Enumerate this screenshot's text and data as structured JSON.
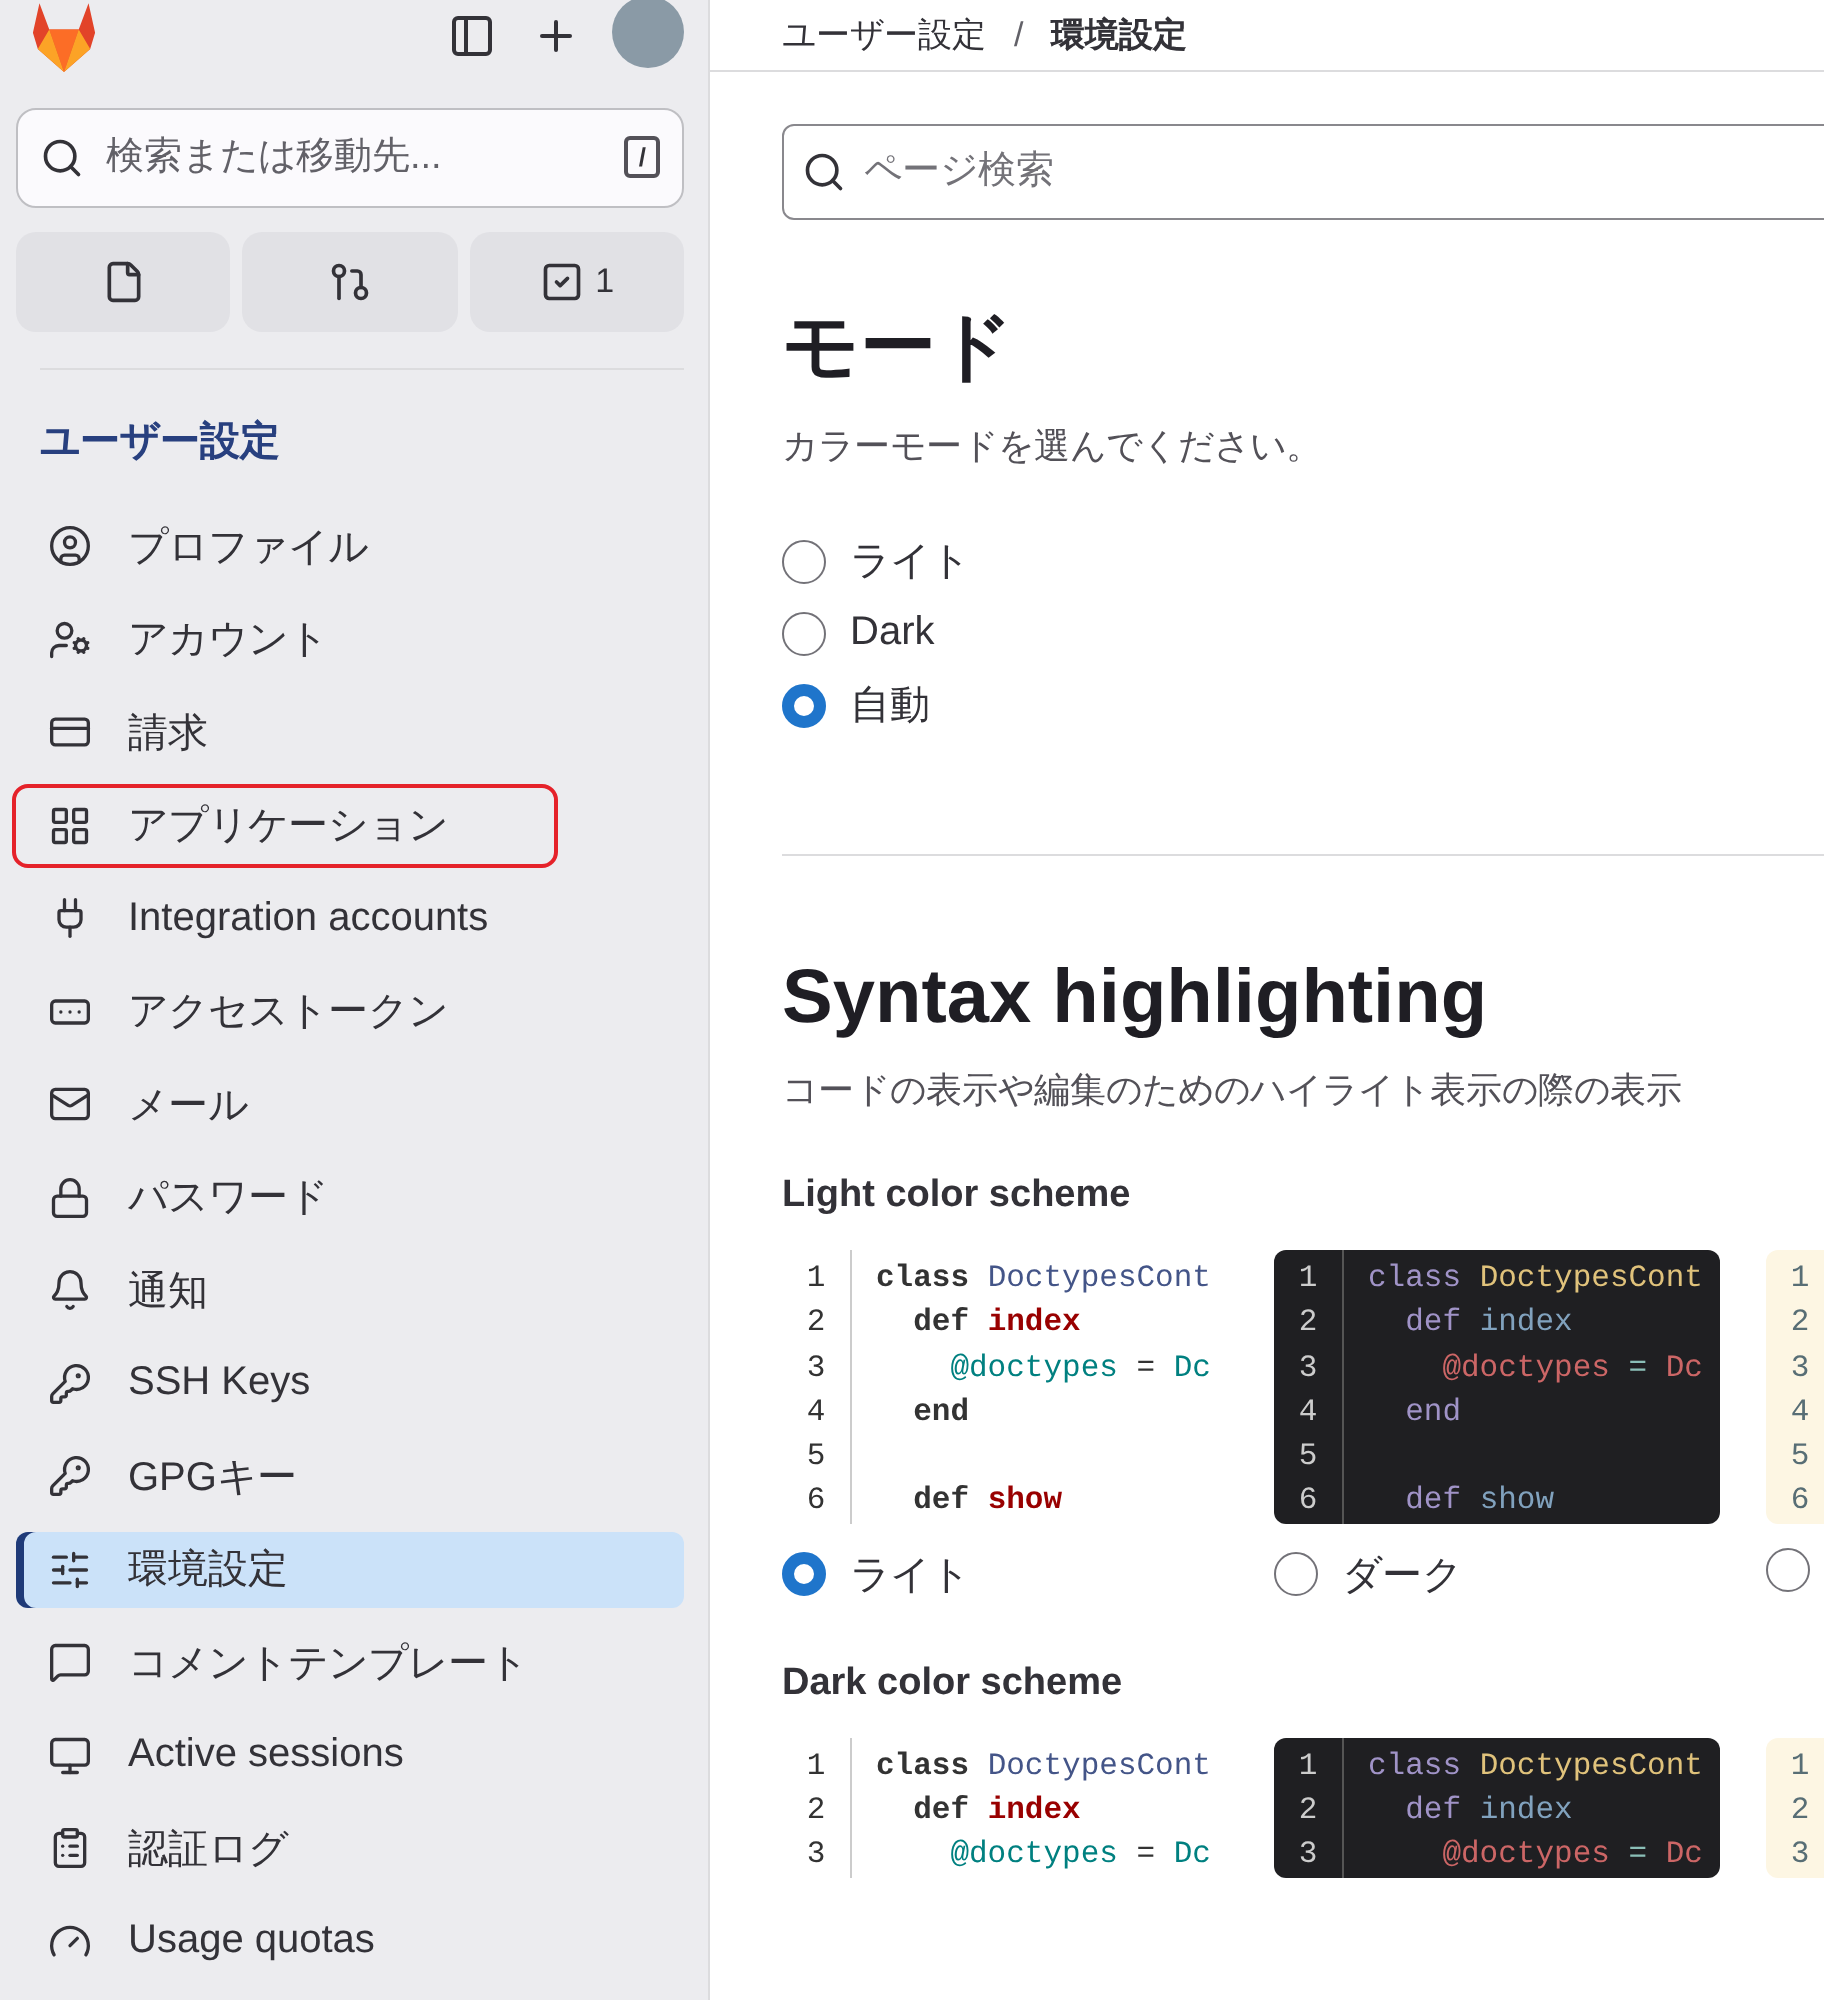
{
  "sidebar": {
    "search": {
      "placeholder": "検索または移動先...",
      "shortcut": "/"
    },
    "quick_buttons": [
      {
        "kind": "issues"
      },
      {
        "kind": "merge_requests"
      },
      {
        "kind": "todos",
        "count": "1"
      }
    ],
    "heading": "ユーザー設定",
    "items": [
      {
        "label": "プロファイル",
        "selected": false,
        "highlighted": false
      },
      {
        "label": "アカウント",
        "selected": false,
        "highlighted": false
      },
      {
        "label": "請求",
        "selected": false,
        "highlighted": false
      },
      {
        "label": "アプリケーション",
        "selected": false,
        "highlighted": true
      },
      {
        "label": "Integration accounts",
        "selected": false,
        "highlighted": false
      },
      {
        "label": "アクセストークン",
        "selected": false,
        "highlighted": false
      },
      {
        "label": "メール",
        "selected": false,
        "highlighted": false
      },
      {
        "label": "パスワード",
        "selected": false,
        "highlighted": false
      },
      {
        "label": "通知",
        "selected": false,
        "highlighted": false
      },
      {
        "label": "SSH Keys",
        "selected": false,
        "highlighted": false
      },
      {
        "label": "GPGキー",
        "selected": false,
        "highlighted": false
      },
      {
        "label": "環境設定",
        "selected": true,
        "highlighted": false
      },
      {
        "label": "コメントテンプレート",
        "selected": false,
        "highlighted": false
      },
      {
        "label": "Active sessions",
        "selected": false,
        "highlighted": false
      },
      {
        "label": "認証ログ",
        "selected": false,
        "highlighted": false
      },
      {
        "label": "Usage quotas",
        "selected": false,
        "highlighted": false
      }
    ]
  },
  "breadcrumb": [
    {
      "label": "ユーザー設定",
      "current": false
    },
    {
      "label": "環境設定",
      "current": true
    }
  ],
  "breadcrumb_separator": "/",
  "page_search": {
    "placeholder": "ページ検索"
  },
  "mode": {
    "title": "モード",
    "description": "カラーモードを選んでください。",
    "options": [
      {
        "label": "ライト",
        "selected": false
      },
      {
        "label": "Dark",
        "selected": false
      },
      {
        "label": "自動",
        "selected": true
      }
    ]
  },
  "syntax": {
    "title": "Syntax highlighting",
    "description": "コードの表示や編集のためのハイライト表示の際の表示",
    "groups": [
      {
        "title": "Light color scheme",
        "schemes": [
          {
            "kind": "light",
            "label": "ライト",
            "selected": true,
            "lines": [
              {
                "n": "1",
                "tokens": [
                  {
                    "text": "class",
                    "color": "#333333",
                    "bold": true
                  },
                  {
                    "text": "DoctypesCont",
                    "color": "#445588"
                  }
                ]
              },
              {
                "n": "2",
                "tokens": [
                  {
                    "text": "  def",
                    "color": "#333333",
                    "bold": true
                  },
                  {
                    "text": "index",
                    "color": "#990000",
                    "bold": true
                  }
                ]
              },
              {
                "n": "3",
                "tokens": [
                  {
                    "text": "    @doctypes",
                    "color": "#008080"
                  },
                  {
                    "text": "=",
                    "color": "#333333"
                  },
                  {
                    "text": "Dc",
                    "color": "#008080"
                  }
                ]
              },
              {
                "n": "4",
                "tokens": [
                  {
                    "text": "  end",
                    "color": "#333333",
                    "bold": true
                  }
                ]
              },
              {
                "n": "5"
              },
              {
                "n": "6",
                "tokens": [
                  {
                    "text": "  def",
                    "color": "#333333",
                    "bold": true
                  },
                  {
                    "text": "show",
                    "color": "#990000",
                    "bold": true
                  }
                ]
              }
            ]
          },
          {
            "kind": "dark",
            "label": "ダーク",
            "selected": false,
            "lines": [
              {
                "n": "1",
                "tokens": [
                  {
                    "text": "class",
                    "color": "#a093c7"
                  },
                  {
                    "text": "DoctypesCont",
                    "color": "#e0c27b"
                  }
                ]
              },
              {
                "n": "2",
                "tokens": [
                  {
                    "text": "  def",
                    "color": "#a093c7"
                  },
                  {
                    "text": "index",
                    "color": "#81a2be"
                  }
                ]
              },
              {
                "n": "3",
                "tokens": [
                  {
                    "text": "    @doctypes",
                    "color": "#cc6666"
                  },
                  {
                    "text": "=",
                    "color": "#8abeb7"
                  },
                  {
                    "text": "Dc",
                    "color": "#cc6666"
                  }
                ]
              },
              {
                "n": "4",
                "tokens": [
                  {
                    "text": "  end",
                    "color": "#a093c7"
                  }
                ]
              },
              {
                "n": "5"
              },
              {
                "n": "6",
                "tokens": [
                  {
                    "text": "  def",
                    "color": "#a093c7"
                  },
                  {
                    "text": "show",
                    "color": "#81a2be"
                  }
                ]
              }
            ]
          },
          {
            "kind": "solarized",
            "selected": false,
            "lines": [
              {
                "n": "1"
              },
              {
                "n": "2"
              },
              {
                "n": "3"
              },
              {
                "n": "4"
              },
              {
                "n": "5"
              },
              {
                "n": "6"
              }
            ]
          }
        ]
      },
      {
        "title": "Dark color scheme",
        "schemes": [
          {
            "kind": "light",
            "lines": [
              {
                "n": "1",
                "tokens": [
                  {
                    "text": "class",
                    "color": "#333333",
                    "bold": true
                  },
                  {
                    "text": "DoctypesCont",
                    "color": "#445588"
                  }
                ]
              },
              {
                "n": "2",
                "tokens": [
                  {
                    "text": "  def",
                    "color": "#333333",
                    "bold": true
                  },
                  {
                    "text": "index",
                    "color": "#990000",
                    "bold": true
                  }
                ]
              },
              {
                "n": "3",
                "tokens": [
                  {
                    "text": "    @doctypes",
                    "color": "#008080"
                  },
                  {
                    "text": "=",
                    "color": "#333333"
                  },
                  {
                    "text": "Dc",
                    "color": "#008080"
                  }
                ]
              }
            ]
          },
          {
            "kind": "dark",
            "lines": [
              {
                "n": "1",
                "tokens": [
                  {
                    "text": "class",
                    "color": "#a093c7"
                  },
                  {
                    "text": "DoctypesCont",
                    "color": "#e0c27b"
                  }
                ]
              },
              {
                "n": "2",
                "tokens": [
                  {
                    "text": "  def",
                    "color": "#a093c7"
                  },
                  {
                    "text": "index",
                    "color": "#81a2be"
                  }
                ]
              },
              {
                "n": "3",
                "tokens": [
                  {
                    "text": "    @doctypes",
                    "color": "#cc6666"
                  },
                  {
                    "text": "=",
                    "color": "#8abeb7"
                  },
                  {
                    "text": "Dc",
                    "color": "#cc6666"
                  }
                ]
              }
            ]
          },
          {
            "kind": "solarized",
            "lines": [
              {
                "n": "1"
              },
              {
                "n": "2"
              },
              {
                "n": "3"
              }
            ]
          }
        ]
      }
    ]
  }
}
